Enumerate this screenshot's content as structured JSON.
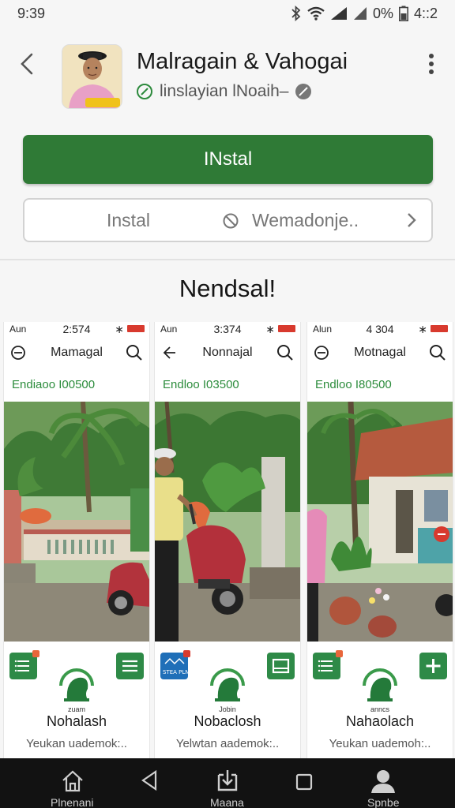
{
  "status_bar": {
    "time": "9:39",
    "battery_text": "0%",
    "clock_right": "4::2"
  },
  "app": {
    "title": "Malragain & Vahogai",
    "subtitle": "linslayian lNoaih–"
  },
  "actions": {
    "install_label": "INstal",
    "secondary_left_label": "Instal",
    "secondary_right_label": "Wemadonje.."
  },
  "section": {
    "title": "Nendsal!"
  },
  "screenshots": [
    {
      "status_left": "Aun",
      "status_time": "2:574",
      "nav_title": "Mamagal",
      "green_text": "Endiaoo I00500",
      "logo_tag": "zuam",
      "name": "Nohalash",
      "desc": "Yeukan uademok:.."
    },
    {
      "status_left": "Aun",
      "status_time": "3:374",
      "nav_title": "Nonnajal",
      "green_text": "Endloo I03500",
      "tile_text": "STEA PLN",
      "logo_tag": "Jobin",
      "name": "Nobaclosh",
      "desc": "Yelwtan aademok:.."
    },
    {
      "status_left": "Alun",
      "status_time": "4 304",
      "nav_title": "Motnagal",
      "green_text": "Endloo I80500",
      "logo_tag": "anncs",
      "name": "Nahaolach",
      "desc": "Yeukan uademoh:.."
    }
  ],
  "bottom_nav": {
    "items": [
      {
        "label": "Plnenani",
        "icon": "home-icon"
      },
      {
        "label": "",
        "icon": "back-triangle-icon"
      },
      {
        "label": "Maana",
        "icon": "download-icon"
      },
      {
        "label": "",
        "icon": "recents-square-icon"
      },
      {
        "label": "Spnbe",
        "icon": "profile-icon"
      }
    ]
  },
  "colors": {
    "install_green": "#2f7a36",
    "accent_green": "#2e8a47",
    "nav_dark": "#121212"
  }
}
